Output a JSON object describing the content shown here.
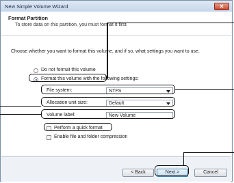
{
  "window": {
    "title": "New Simple Volume Wizard",
    "close_label": "✕"
  },
  "header": {
    "title": "Format Partition",
    "subtitle": "To store data on this partition, you must format it first."
  },
  "body": {
    "instruction": "Choose whether you want to format this volume, and if so, what settings you want to use.",
    "options": [
      {
        "label": "Do not format this volume",
        "selected": false
      },
      {
        "label": "Format this volume with the following settings:",
        "selected": true
      }
    ],
    "file_system": {
      "label": "File system:",
      "value": "NTFS"
    },
    "allocation_unit": {
      "label": "Allocation unit size:",
      "value": "Default"
    },
    "volume_label": {
      "label": "Volume label:",
      "value": "New Volume"
    },
    "checkboxes": [
      {
        "label": "Perform a quick format",
        "checked": false
      },
      {
        "label": "Enable file and folder compression",
        "checked": false
      }
    ]
  },
  "footer": {
    "back_label": "< Back",
    "next_label": "Next >",
    "cancel_label": "Cancel"
  }
}
